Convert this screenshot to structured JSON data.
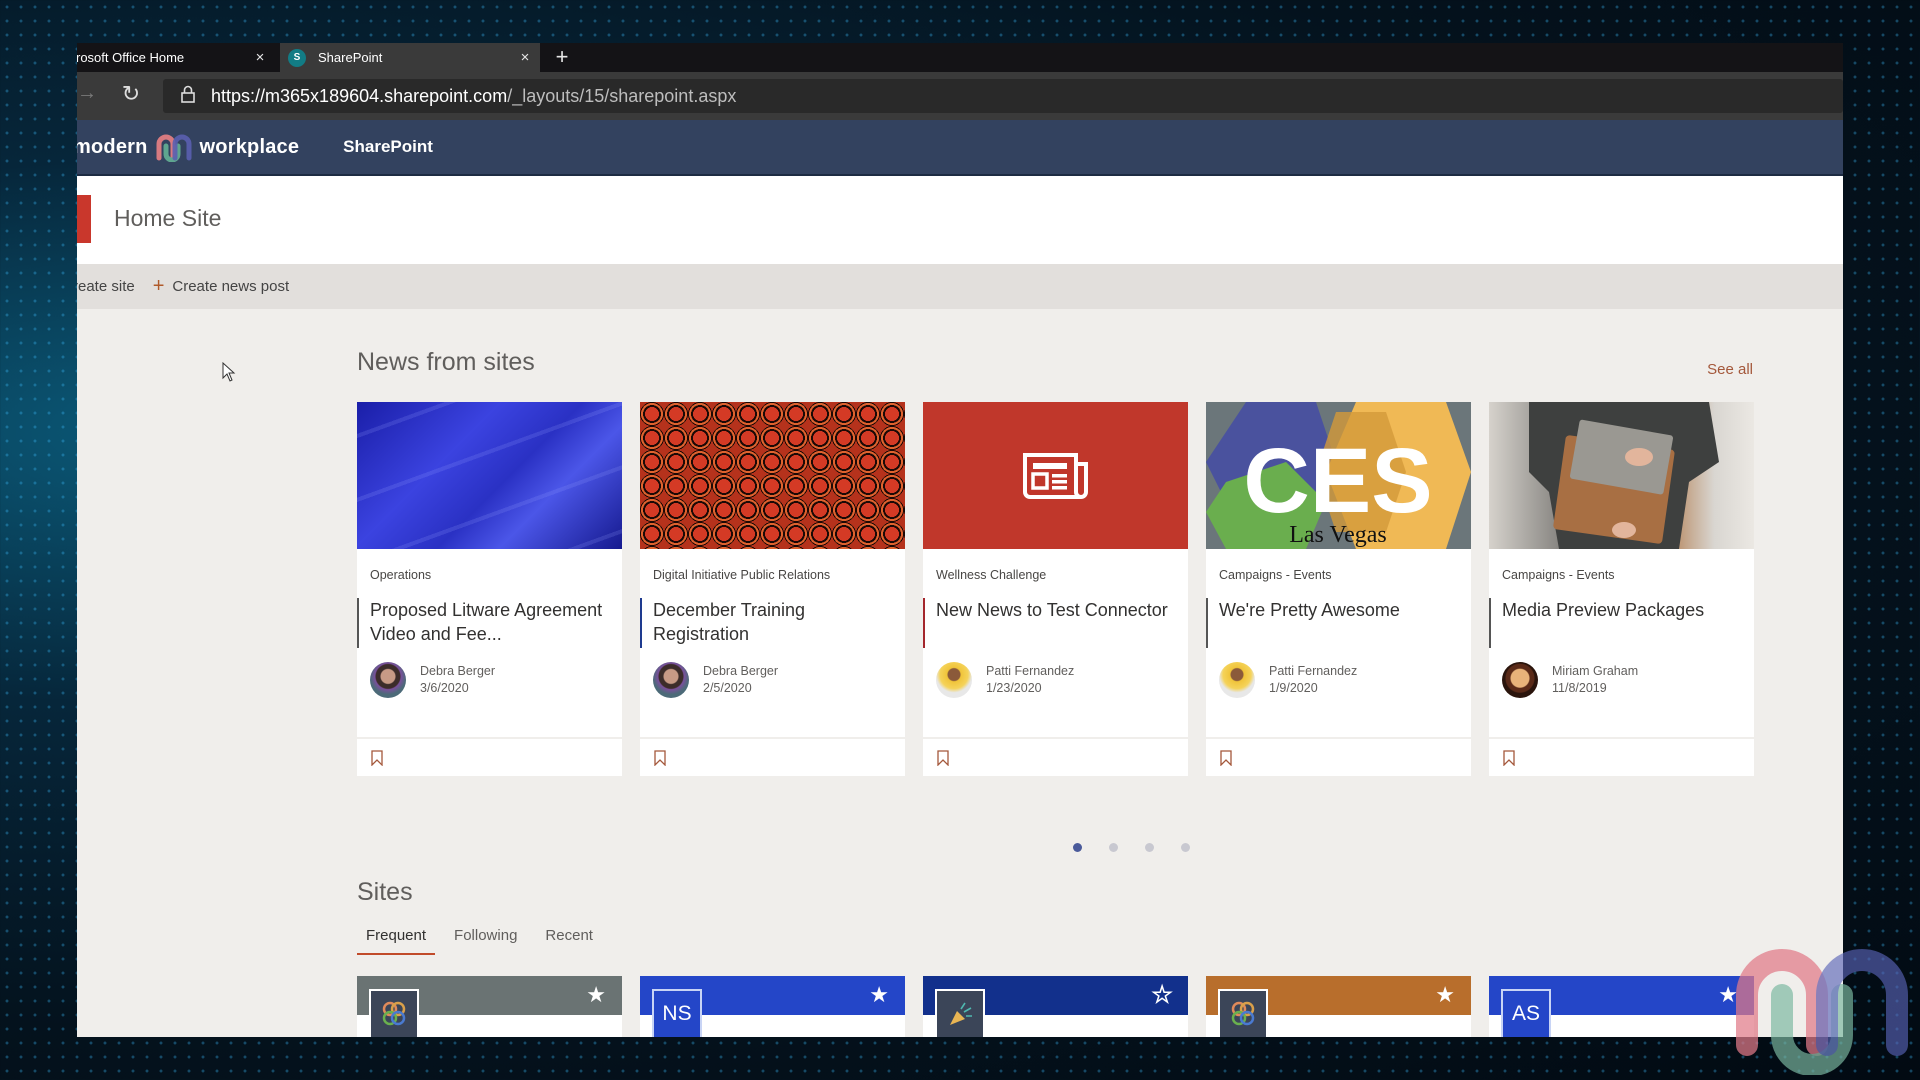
{
  "browser": {
    "tabs": [
      {
        "title": "rosoft Office Home",
        "close_icon": "×",
        "active": false
      },
      {
        "title": "SharePoint",
        "favicon_letter": "S",
        "close_icon": "×",
        "active": true
      }
    ],
    "new_tab_icon": "+",
    "forward_icon": "→",
    "reload_icon": "↻",
    "lock_icon": "🔒",
    "url_host": "https://m365x189604.sharepoint.com",
    "url_path": "/_layouts/15/sharepoint.aspx"
  },
  "suite_bar": {
    "brand_left": "modern",
    "brand_right": "workplace",
    "app_name": "SharePoint",
    "color": "#33425f"
  },
  "site_header": {
    "title": "Home Site",
    "logo_color": "#c9372c"
  },
  "command_bar": {
    "items": [
      {
        "label": "reate site"
      },
      {
        "label": "Create news post",
        "icon": "+"
      }
    ]
  },
  "news": {
    "title": "News from sites",
    "see_all": "See all",
    "cards": [
      {
        "site": "Operations",
        "headline": "Proposed Litware Agreement Video and Fee...",
        "author": "Debra Berger",
        "date": "3/6/2020",
        "image": "blue-abstract"
      },
      {
        "site": "Digital Initiative Public Relations",
        "headline": "December Training Registration",
        "author": "Debra Berger",
        "date": "2/5/2020",
        "image": "hexagon-pattern"
      },
      {
        "site": "Wellness Challenge",
        "headline": "New News to Test Connector",
        "author": "Patti Fernandez",
        "date": "1/23/2020",
        "image": "news-placeholder"
      },
      {
        "site": "Campaigns - Events",
        "headline": "We're Pretty Awesome",
        "author": "Patti Fernandez",
        "date": "1/9/2020",
        "image": "ces-las-vegas",
        "image_text_main": "CES",
        "image_text_sub": "Las Vegas"
      },
      {
        "site": "Campaigns - Events",
        "headline": "Media Preview Packages",
        "author": "Miriam Graham",
        "date": "11/8/2019",
        "image": "person-with-laptop-sleeve"
      }
    ],
    "pagination": {
      "pages": 4,
      "current": 1
    }
  },
  "sites": {
    "title": "Sites",
    "tabs": [
      {
        "label": "Frequent",
        "active": true
      },
      {
        "label": "Following",
        "active": false
      },
      {
        "label": "Recent",
        "active": false
      }
    ],
    "cards": [
      {
        "banner_color": "#6a7373",
        "logo_type": "knot-icon",
        "logo_bg": "#3b4558",
        "followed": true
      },
      {
        "banner_color": "#2446c8",
        "logo_text": "NS",
        "logo_bg": "#2446c8",
        "followed": true
      },
      {
        "banner_color": "#12308c",
        "logo_type": "megaphone-icon",
        "logo_bg": "#3b4558",
        "followed": false
      },
      {
        "banner_color": "#b86e2c",
        "logo_type": "knot-icon",
        "logo_bg": "#3b4558",
        "followed": true
      },
      {
        "banner_color": "#2446c8",
        "logo_text": "AS",
        "logo_bg": "#2446c8",
        "followed": true
      }
    ]
  }
}
